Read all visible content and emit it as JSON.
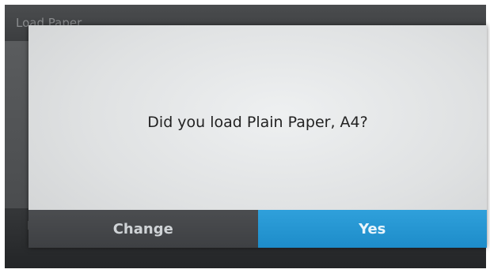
{
  "background": {
    "title": "Load Paper",
    "footer_text": "L"
  },
  "dialog": {
    "message": "Did you load Plain Paper, A4?",
    "change_label": "Change",
    "yes_label": "Yes",
    "accent_color": "#1d8cc9"
  }
}
